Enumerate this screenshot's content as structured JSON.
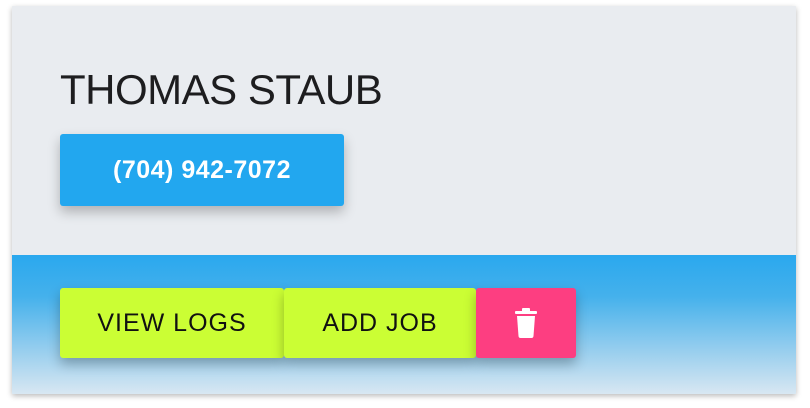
{
  "contact": {
    "name": "THOMAS STAUB",
    "phone": "(704) 942-7072"
  },
  "actions": {
    "view_logs_label": "VIEW LOGS",
    "add_job_label": "ADD JOB",
    "delete_icon": "trash-icon"
  },
  "colors": {
    "card_background": "#e9ecf0",
    "phone_button": "#22a7ef",
    "action_button": "#cbfe34",
    "delete_button": "#fd3e81",
    "footer_gradient_top": "#2aa8ee",
    "footer_gradient_bottom": "#d8e7f2"
  }
}
